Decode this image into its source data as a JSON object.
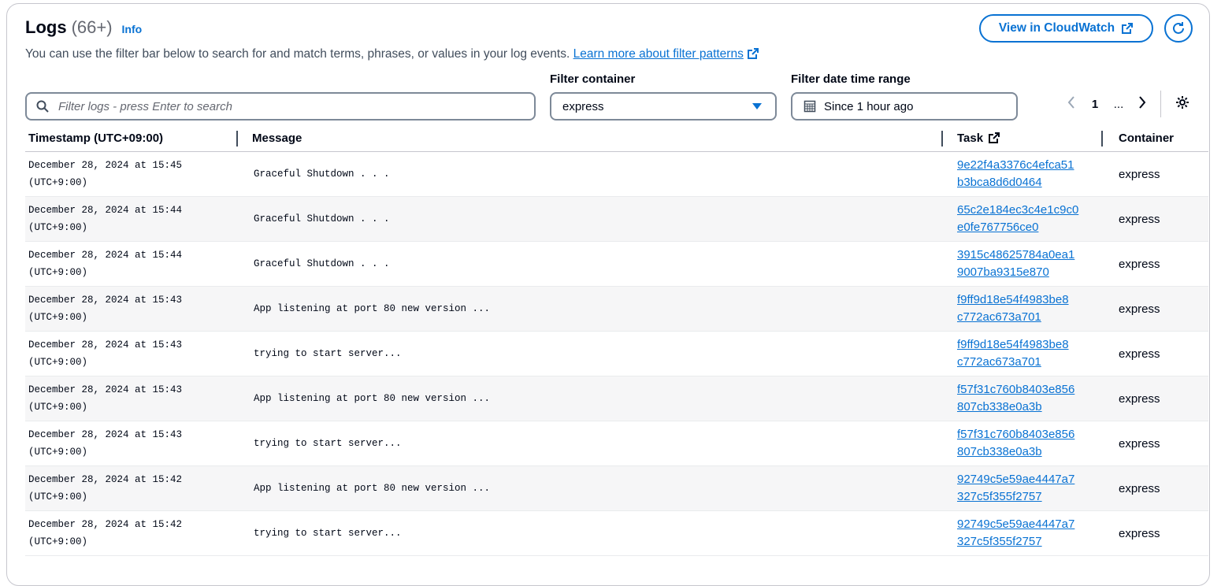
{
  "header": {
    "title": "Logs",
    "count": "(66+)",
    "info_label": "Info",
    "description": "You can use the filter bar below to search for and match terms, phrases, or values in your log events.",
    "learn_more": "Learn more about filter patterns",
    "view_cloudwatch": "View in CloudWatch"
  },
  "filters": {
    "search_placeholder": "Filter logs - press Enter to search",
    "container_label": "Filter container",
    "container_value": "express",
    "date_label": "Filter date time range",
    "date_value": "Since 1 hour ago"
  },
  "pagination": {
    "current": "1",
    "ellipsis": "..."
  },
  "colors": {
    "accent": "#0972d3",
    "border": "#7d8998",
    "alt_row": "#f6f6f7"
  },
  "table": {
    "columns": [
      "Timestamp (UTC+09:00)",
      "Message",
      "Task",
      "Container"
    ],
    "rows": [
      {
        "date": "December 28, 2024 at 15:45",
        "tz": "(UTC+9:00)",
        "message": "Graceful Shutdown . . .",
        "task1": "9e22f4a3376c4efca51",
        "task2": "b3bca8d6d0464",
        "container": "express"
      },
      {
        "date": "December 28, 2024 at 15:44",
        "tz": "(UTC+9:00)",
        "message": "Graceful Shutdown . . .",
        "task1": "65c2e184ec3c4e1c9c0",
        "task2": "e0fe767756ce0",
        "container": "express"
      },
      {
        "date": "December 28, 2024 at 15:44",
        "tz": "(UTC+9:00)",
        "message": "Graceful Shutdown . . .",
        "task1": "3915c48625784a0ea1",
        "task2": "9007ba9315e870",
        "container": "express"
      },
      {
        "date": "December 28, 2024 at 15:43",
        "tz": "(UTC+9:00)",
        "message": "App listening at port 80 new version ...",
        "task1": "f9ff9d18e54f4983be8",
        "task2": "c772ac673a701",
        "container": "express"
      },
      {
        "date": "December 28, 2024 at 15:43",
        "tz": "(UTC+9:00)",
        "message": "trying to start server...",
        "task1": "f9ff9d18e54f4983be8",
        "task2": "c772ac673a701",
        "container": "express"
      },
      {
        "date": "December 28, 2024 at 15:43",
        "tz": "(UTC+9:00)",
        "message": "App listening at port 80 new version ...",
        "task1": "f57f31c760b8403e856",
        "task2": "807cb338e0a3b",
        "container": "express"
      },
      {
        "date": "December 28, 2024 at 15:43",
        "tz": "(UTC+9:00)",
        "message": "trying to start server...",
        "task1": "f57f31c760b8403e856",
        "task2": "807cb338e0a3b",
        "container": "express"
      },
      {
        "date": "December 28, 2024 at 15:42",
        "tz": "(UTC+9:00)",
        "message": "App listening at port 80 new version ...",
        "task1": "92749c5e59ae4447a7",
        "task2": "327c5f355f2757",
        "container": "express"
      },
      {
        "date": "December 28, 2024 at 15:42",
        "tz": "(UTC+9:00)",
        "message": "trying to start server...",
        "task1": "92749c5e59ae4447a7",
        "task2": "327c5f355f2757",
        "container": "express"
      }
    ]
  }
}
